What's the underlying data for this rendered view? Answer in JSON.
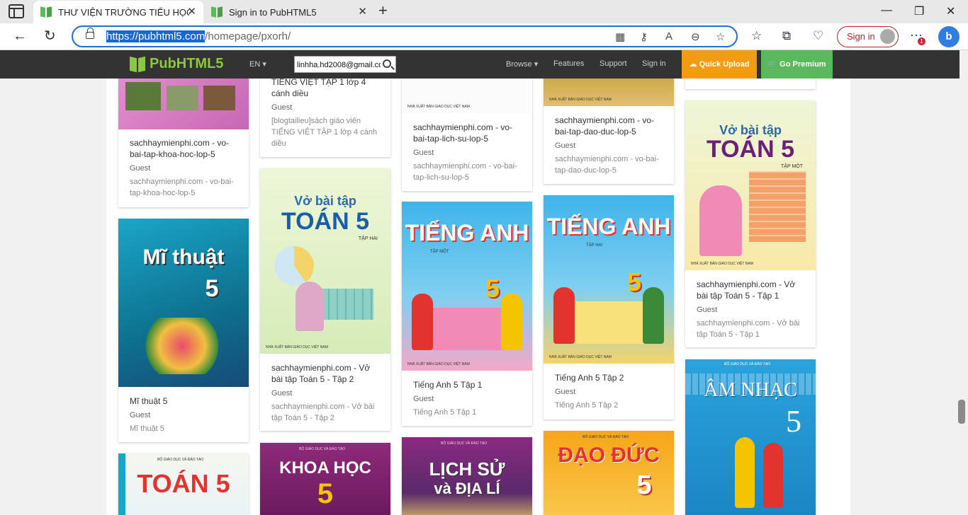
{
  "browser": {
    "tabs": [
      {
        "title": "THƯ VIỆN TRƯỜNG TIỂU HỌC H..."
      },
      {
        "title": "Sign in to PubHTML5"
      }
    ],
    "url_host": "https://pubhtml5.com",
    "url_path": "/homepage/pxorh/",
    "signin_label": "Sign in",
    "notification_count": "1",
    "bing_label": "b"
  },
  "site": {
    "logo": "PubHTML5",
    "lang": "EN ▾",
    "search_value": "linhha.hd2008@gmail.co",
    "nav": {
      "browse": "Browse ▾",
      "features": "Features",
      "support": "Support",
      "signin": "Sign in"
    },
    "quick_upload": "Quick Upload",
    "go_premium": "Go Premium"
  },
  "cards": {
    "c1": {
      "title": "sachhaymienphi.com - vo-bai-tap-khoa-hoc-lop-5",
      "author": "Guest",
      "desc": "sachhaymienphi.com - vo-bai-tap-khoa-hoc-lop-5"
    },
    "c2": {
      "title": "TIẾNG VIỆT TẬP 1 lớp 4 cánh diều",
      "author": "Guest",
      "desc": "[blogtailieu]sách giáo viên TIẾNG VIỆT TẬP 1 lớp 4 cánh diều"
    },
    "c3": {
      "title": "sachhaymienphi.com - vo-bai-tap-lich-su-lop-5",
      "author": "Guest",
      "desc": "sachhaymienphi.com - vo-bai-tap-lich-su-lop-5"
    },
    "c4": {
      "title": "sachhaymienphi.com - vo-bai-tap-dao-duc-lop-5",
      "author": "Guest",
      "desc": "sachhaymienphi.com - vo-bai-tap-dao-duc-lop-5"
    },
    "c6": {
      "title": "Mĩ thuật 5",
      "author": "Guest",
      "desc": "Mĩ thuật 5",
      "cover_text": "Mĩ thuật",
      "cover_num": "5"
    },
    "c7": {
      "title": "sachhaymienphi.com - Vở bài tập Toán 5 - Tập 2",
      "author": "Guest",
      "desc": "sachhaymienphi.com - Vở bài tập Toán 5 - Tập 2",
      "cover_small": "Vở bài tập",
      "cover_big": "TOÁN 5",
      "cover_sub": "TẬP HAI"
    },
    "c8": {
      "title": "Tiếng Anh 5 Tập 1",
      "author": "Guest",
      "desc": "Tiếng Anh 5 Tập 1",
      "cover_big": "TIẾNG ANH",
      "cover_num": "5",
      "cover_sub": "TẬP MỘT"
    },
    "c9": {
      "title": "Tiếng Anh 5 Tập 2",
      "author": "Guest",
      "desc": "Tiếng Anh 5 Tập 2",
      "cover_big": "TIẾNG ANH",
      "cover_num": "5",
      "cover_sub": "TẬP HAI"
    },
    "c10": {
      "title": "sachhaymienphi.com - Vở bài tập Toán 5 - Tập 1",
      "author": "Guest",
      "desc": "sachhaymienphi.com - Vở bài tập Toán 5 - Tập 1",
      "cover_small": "Vở bài tập",
      "cover_big": "TOÁN 5",
      "cover_sub": "TẬP MỘT"
    },
    "c11": {
      "cover_big": "ÂM NHẠC",
      "cover_num": "5",
      "cover_pub": "BỘ GIÁO DỤC VÀ ĐÀO TẠO"
    },
    "c12": {
      "cover_big": "TOÁN 5",
      "cover_pub": "BỘ GIÁO DỤC VÀ ĐÀO TẠO"
    },
    "c13": {
      "cover_big": "KHOA HỌC",
      "cover_num": "5",
      "cover_pub": "BỘ GIÁO DỤC VÀ ĐÀO TẠO"
    },
    "c14": {
      "cover_big": "LỊCH SỬ",
      "cover_sub": "và ĐỊA LÍ",
      "cover_pub": "BỘ GIÁO DỤC VÀ ĐÀO TẠO"
    },
    "c15": {
      "cover_big": "ĐẠO ĐỨC",
      "cover_num": "5",
      "cover_pub": "BỘ GIÁO DỤC VÀ ĐÀO TẠO"
    }
  },
  "publisher_line": "NHÀ XUẤT BẢN GIÁO DỤC VIỆT NAM"
}
